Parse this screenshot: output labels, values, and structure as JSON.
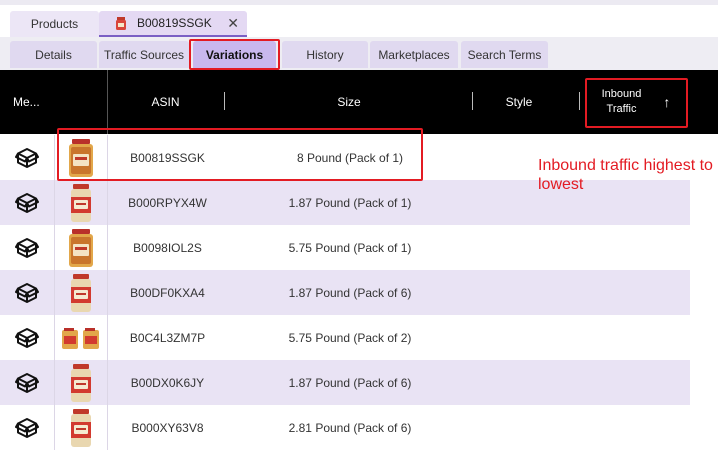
{
  "doc_tabs": {
    "products_label": "Products",
    "active_label": "B00819SSGK",
    "active_icon": "product-thumbnail-icon",
    "close_icon": "close-icon",
    "close_glyph": "✕"
  },
  "sub_tabs": [
    {
      "label": "Details"
    },
    {
      "label": "Traffic Sources"
    },
    {
      "label": "Variations"
    },
    {
      "label": "History"
    },
    {
      "label": "Marketplaces"
    },
    {
      "label": "Search Terms"
    }
  ],
  "grid": {
    "headers": {
      "media": "Me...",
      "asin": "ASIN",
      "size": "Size",
      "style": "Style",
      "inbound_line1": "Inbound",
      "inbound_line2": "Traffic",
      "sort_icon": "arrow-up-icon",
      "sort_glyph": "↑"
    },
    "rows": [
      {
        "asin": "B00819SSGK",
        "size": "8 Pound (Pack of 1)",
        "icon": "box-icon",
        "thumb": "jug"
      },
      {
        "asin": "B000RPYX4W",
        "size": "1.87 Pound (Pack of 1)",
        "icon": "box-icon",
        "thumb": "jar"
      },
      {
        "asin": "B0098IOL2S",
        "size": "5.75 Pound (Pack of 1)",
        "icon": "box-icon",
        "thumb": "jug"
      },
      {
        "asin": "B00DF0KXA4",
        "size": "1.87 Pound (Pack of 6)",
        "icon": "box-icon",
        "thumb": "jar"
      },
      {
        "asin": "B0C4L3ZM7P",
        "size": "5.75 Pound (Pack of 2)",
        "icon": "box-icon",
        "thumb": "pair"
      },
      {
        "asin": "B00DX0K6JY",
        "size": "1.87 Pound (Pack of 6)",
        "icon": "box-icon",
        "thumb": "jar"
      },
      {
        "asin": "B000XY63V8",
        "size": "2.81 Pound (Pack of 6)",
        "icon": "box-icon",
        "thumb": "jar"
      }
    ]
  },
  "annotation": "Inbound traffic highest to lowest",
  "colors": {
    "highlight": "#e31b23",
    "header_bg": "#000000",
    "alt_row": "#e9e3f4",
    "active_tab": "#c9b8ee"
  }
}
